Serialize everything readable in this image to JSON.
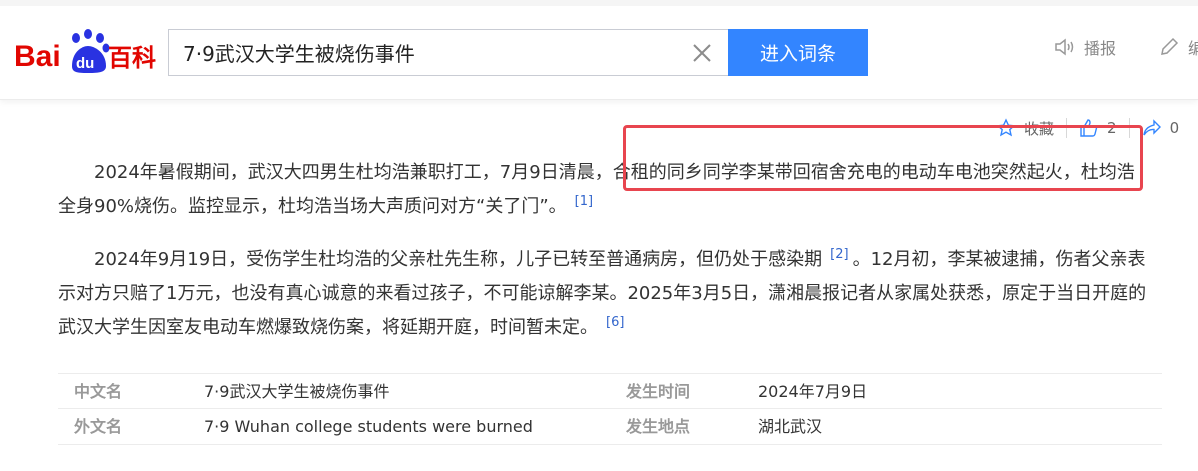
{
  "header": {
    "logo_text_left": "Bai",
    "logo_text_du": "du",
    "logo_text_right": "百科",
    "search_value": "7·9武汉大学生被烧伤事件",
    "search_button": "进入词条",
    "broadcast_label": "播报",
    "edit_label": "编"
  },
  "actions": {
    "collect_label": "收藏",
    "like_count": "2",
    "share_count": "0"
  },
  "content": {
    "p1_text": "2024年暑假期间，武汉大四男生杜均浩兼职打工，7月9日清晨，合租的同乡同学李某带回宿舍充电的电动车电池突然起火，杜均浩全身90%烧伤。监控显示，杜均浩当场大声质问对方“关了门”。",
    "p1_ref": "[1]",
    "p2_text_a": "2024年9月19日，受伤学生杜均浩的父亲杜先生称，儿子已转至普通病房，但仍处于感染期",
    "p2_ref_a": "[2]",
    "p2_text_b": "。12月初，李某被逮捕，伤者父亲表示对方只赔了1万元，也没有真心诚意的来看过孩子，不可能谅解李某。2025年3月5日，潇湘晨报记者从家属处获悉，原定于当日开庭的武汉大学生因室友电动车燃爆致烧伤案，将延期开庭，时间暂未定。",
    "p2_ref_b": "[6]"
  },
  "info": {
    "rows": [
      {
        "label1": "中文名",
        "value1": "7·9武汉大学生被烧伤事件",
        "label2": "发生时间",
        "value2": "2024年7月9日"
      },
      {
        "label1": "外文名",
        "value1": "7·9 Wuhan college students were burned",
        "label2": "发生地点",
        "value2": "湖北武汉"
      }
    ]
  },
  "colors": {
    "brand_blue": "#3385ff",
    "logo_red": "#e10601",
    "logo_blue": "#2932e1",
    "highlight_red": "#e8454f"
  }
}
